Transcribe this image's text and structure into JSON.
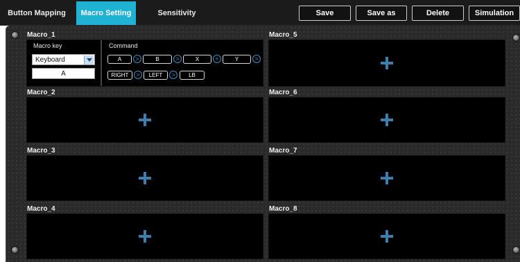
{
  "tabs": [
    {
      "label": "Button Mapping"
    },
    {
      "label": "Macro Setting"
    },
    {
      "label": "Sensitivity"
    }
  ],
  "actions": {
    "save": "Save",
    "save_as": "Save as",
    "delete": "Delete",
    "simulation": "Simulation"
  },
  "colors": {
    "active_tab": "#1fb2d3",
    "plus_icon": "#3a7fae",
    "connector": "#3b8fc4"
  },
  "macros": [
    {
      "title": "Macro_1"
    },
    {
      "title": "Macro_2"
    },
    {
      "title": "Macro_3"
    },
    {
      "title": "Macro_4"
    },
    {
      "title": "Macro_5"
    },
    {
      "title": "Macro_6"
    },
    {
      "title": "Macro_7"
    },
    {
      "title": "Macro_8"
    }
  ],
  "macro1": {
    "key_label": "Macro key",
    "key_type": "Keyboard",
    "key_value": "A",
    "command_label": "Command",
    "commands_row1": [
      "A",
      "B",
      "X",
      "Y"
    ],
    "connectors_row1": [
      ">",
      ">",
      "+",
      ">"
    ],
    "commands_row2": [
      "RIGHT",
      "LEFT",
      "LB"
    ],
    "connectors_row2": [
      ">",
      ">"
    ]
  }
}
